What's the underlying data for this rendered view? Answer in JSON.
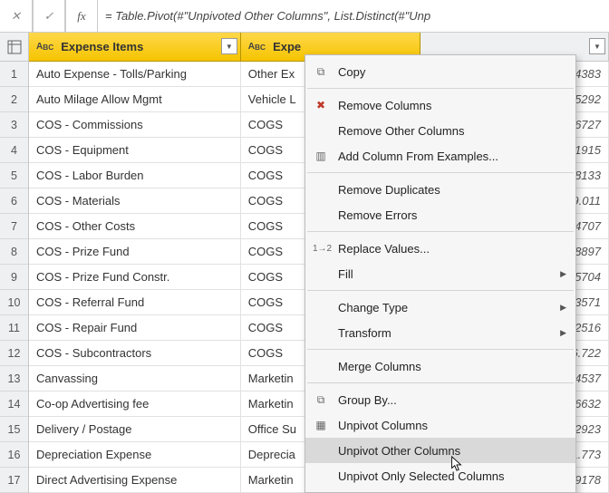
{
  "formula_bar": {
    "fx_label": "fx",
    "formula": "= Table.Pivot(#\"Unpivoted Other Columns\", List.Distinct(#\"Unp"
  },
  "columns": {
    "a": {
      "type": "ABC",
      "label": "Expense Items"
    },
    "b": {
      "type": "ABC",
      "label": "Expe"
    },
    "c": {
      "type": "ABC",
      "label": ""
    }
  },
  "rows": [
    {
      "n": "1",
      "a": "Auto Expense - Tolls/Parking",
      "b": "Other Ex",
      "c": "94383"
    },
    {
      "n": "2",
      "a": "Auto Milage Allow Mgmt",
      "b": "Vehicle L",
      "c": "05292"
    },
    {
      "n": "3",
      "a": "COS - Commissions",
      "b": "COGS",
      "c": ".6727"
    },
    {
      "n": "4",
      "a": "COS - Equipment",
      "b": "COGS",
      "c": "51915"
    },
    {
      "n": "5",
      "a": "COS - Labor Burden",
      "b": "COGS",
      "c": "38133"
    },
    {
      "n": "6",
      "a": "COS - Materials",
      "b": "COGS",
      "c": "9.011"
    },
    {
      "n": "7",
      "a": "COS - Other Costs",
      "b": "COGS",
      "c": ".4707"
    },
    {
      "n": "8",
      "a": "COS - Prize Fund",
      "b": "COGS",
      "c": ".8897"
    },
    {
      "n": "9",
      "a": "COS - Prize Fund Constr.",
      "b": "COGS",
      "c": ".5704"
    },
    {
      "n": "10",
      "a": "COS - Referral Fund",
      "b": "COGS",
      "c": "13571"
    },
    {
      "n": "11",
      "a": "COS - Repair Fund",
      "b": "COGS",
      "c": "12516"
    },
    {
      "n": "12",
      "a": "COS - Subcontractors",
      "b": "COGS",
      "c": "6.722"
    },
    {
      "n": "13",
      "a": "Canvassing",
      "b": "Marketin",
      "c": ".4537"
    },
    {
      "n": "14",
      "a": "Co-op Advertising fee",
      "b": "Marketin",
      "c": ".6632"
    },
    {
      "n": "15",
      "a": "Delivery / Postage",
      "b": "Office Su",
      "c": "32923"
    },
    {
      "n": "16",
      "a": "Depreciation Expense",
      "b": "Deprecia",
      "c": "1.773"
    },
    {
      "n": "17",
      "a": "Direct Advertising Expense",
      "b": "Marketin",
      "c": ".9178"
    }
  ],
  "menu": {
    "copy": "Copy",
    "remove_columns": "Remove Columns",
    "remove_other_columns": "Remove Other Columns",
    "add_column_from_examples": "Add Column From Examples...",
    "remove_duplicates": "Remove Duplicates",
    "remove_errors": "Remove Errors",
    "replace_values": "Replace Values...",
    "fill": "Fill",
    "change_type": "Change Type",
    "transform": "Transform",
    "merge_columns": "Merge Columns",
    "group_by": "Group By...",
    "unpivot_columns": "Unpivot Columns",
    "unpivot_other_columns": "Unpivot Other Columns",
    "unpivot_only_selected": "Unpivot Only Selected Columns"
  }
}
